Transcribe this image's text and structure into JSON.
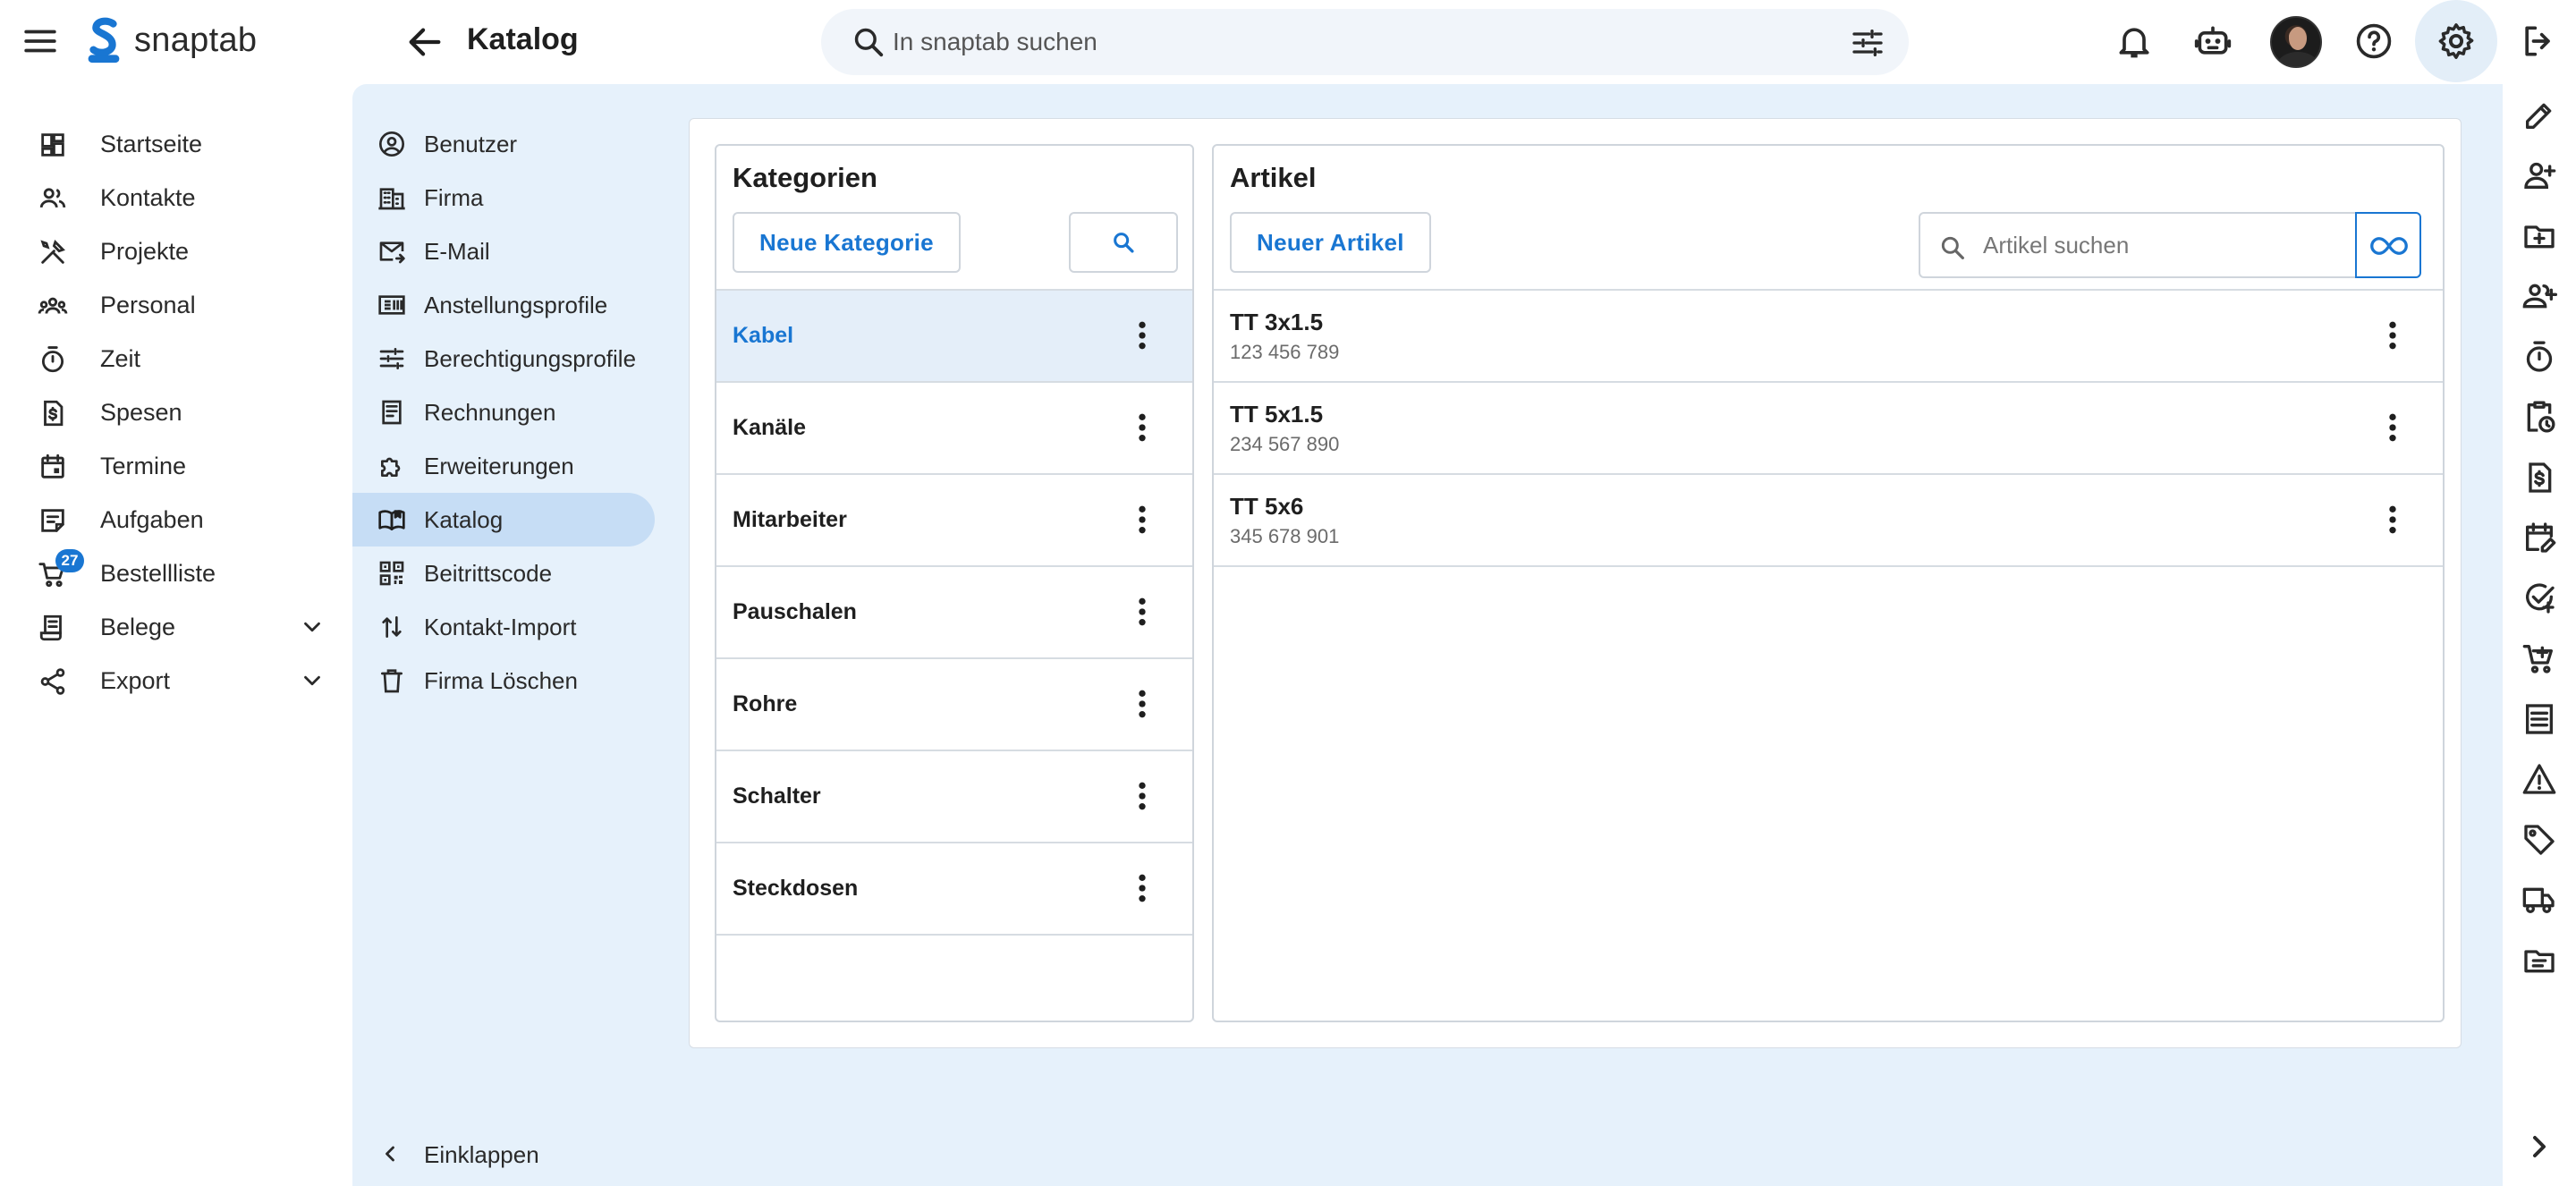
{
  "app": {
    "brand_name": "snaptab",
    "page_title": "Katalog",
    "search_placeholder": "In snaptab suchen"
  },
  "colors": {
    "accent": "#1976d2",
    "settings_background": "#e6f1fb",
    "active_item_background": "#c6ddf5"
  },
  "nav": {
    "items": [
      {
        "label": "Startseite",
        "icon": "dashboard-icon"
      },
      {
        "label": "Kontakte",
        "icon": "contacts-icon"
      },
      {
        "label": "Projekte",
        "icon": "tools-icon"
      },
      {
        "label": "Personal",
        "icon": "groups-icon"
      },
      {
        "label": "Zeit",
        "icon": "timer-icon"
      },
      {
        "label": "Spesen",
        "icon": "receipt-dollar-icon"
      },
      {
        "label": "Termine",
        "icon": "calendar-icon"
      },
      {
        "label": "Aufgaben",
        "icon": "task-note-icon"
      },
      {
        "label": "Bestellliste",
        "icon": "cart-icon",
        "badge": "27"
      },
      {
        "label": "Belege",
        "icon": "receipt-long-icon",
        "expandable": true
      },
      {
        "label": "Export",
        "icon": "share-icon",
        "expandable": true
      }
    ]
  },
  "settings_nav": {
    "items": [
      {
        "label": "Benutzer",
        "icon": "account-circle-icon"
      },
      {
        "label": "Firma",
        "icon": "business-icon"
      },
      {
        "label": "E-Mail",
        "icon": "mail-icon"
      },
      {
        "label": "Anstellungsprofile",
        "icon": "id-card-icon"
      },
      {
        "label": "Berechtigungsprofile",
        "icon": "tune-icon"
      },
      {
        "label": "Rechnungen",
        "icon": "invoice-icon"
      },
      {
        "label": "Erweiterungen",
        "icon": "extension-icon"
      },
      {
        "label": "Katalog",
        "icon": "catalog-book-icon",
        "active": true
      },
      {
        "label": "Beitrittscode",
        "icon": "qr-code-icon"
      },
      {
        "label": "Kontakt-Import",
        "icon": "import-arrows-icon"
      },
      {
        "label": "Firma Löschen",
        "icon": "trash-icon"
      }
    ],
    "collapse_label": "Einklappen"
  },
  "categories": {
    "title": "Kategorien",
    "new_button": "Neue Kategorie",
    "items": [
      {
        "label": "Kabel",
        "active": true
      },
      {
        "label": "Kanäle"
      },
      {
        "label": "Mitarbeiter"
      },
      {
        "label": "Pauschalen"
      },
      {
        "label": "Rohre"
      },
      {
        "label": "Schalter"
      },
      {
        "label": "Steckdosen"
      }
    ]
  },
  "articles": {
    "title": "Artikel",
    "new_button": "Neuer Artikel",
    "search_placeholder": "Artikel suchen",
    "items": [
      {
        "name": "TT 3x1.5",
        "code": "123 456 789"
      },
      {
        "name": "TT 5x1.5",
        "code": "234 567 890"
      },
      {
        "name": "TT 5x6",
        "code": "345 678 901"
      }
    ]
  },
  "right_rail": {
    "icons": [
      "edit-icon",
      "person-add-icon",
      "folder-add-icon",
      "group-add-icon",
      "timer-icon",
      "clipboard-clock-icon",
      "receipt-dollar-icon",
      "calendar-edit-icon",
      "task-check-icon",
      "cart-add-icon",
      "list-doc-icon",
      "warning-icon",
      "tag-icon",
      "truck-icon",
      "folder-doc-icon",
      "chevron-right-icon"
    ]
  }
}
